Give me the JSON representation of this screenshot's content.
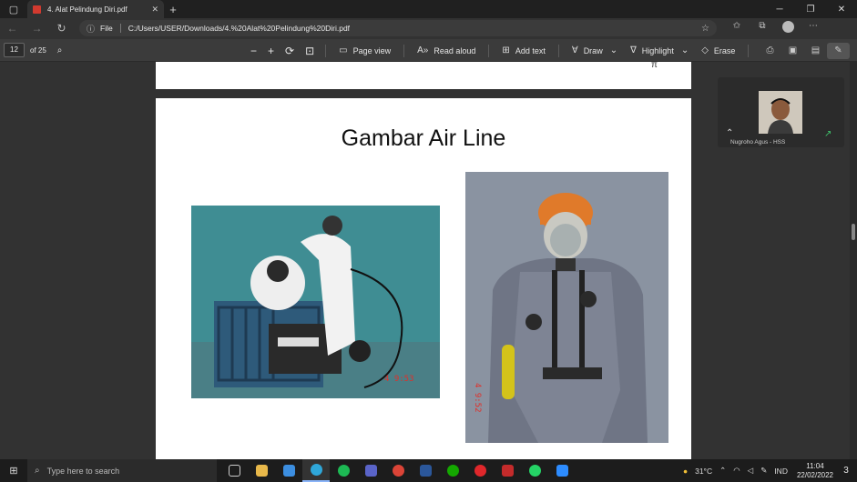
{
  "browser": {
    "tab_title": "4. Alat Pelindung Diri.pdf",
    "protocol_label": "File",
    "url": "C:/Users/USER/Downloads/4.%20Alat%20Pelindung%20Diri.pdf"
  },
  "pdf_toolbar": {
    "page_number": "12",
    "page_total": "of 25",
    "page_view": "Page view",
    "read_aloud": "Read aloud",
    "add_text": "Add text",
    "draw": "Draw",
    "highlight": "Highlight",
    "erase": "Erase"
  },
  "document": {
    "slide_title": "Gambar Air Line",
    "photo1_stamp": "4   9:53",
    "photo2_stamp": "4  9:52",
    "prev_page_mark": "π"
  },
  "meeting": {
    "participant_name": "Nugroho Agus - HSS"
  },
  "taskbar": {
    "search_placeholder": "Type here to search",
    "temperature": "31°C",
    "language": "IND",
    "time": "11:04",
    "date": "22/02/2022",
    "notification_count": "3"
  }
}
